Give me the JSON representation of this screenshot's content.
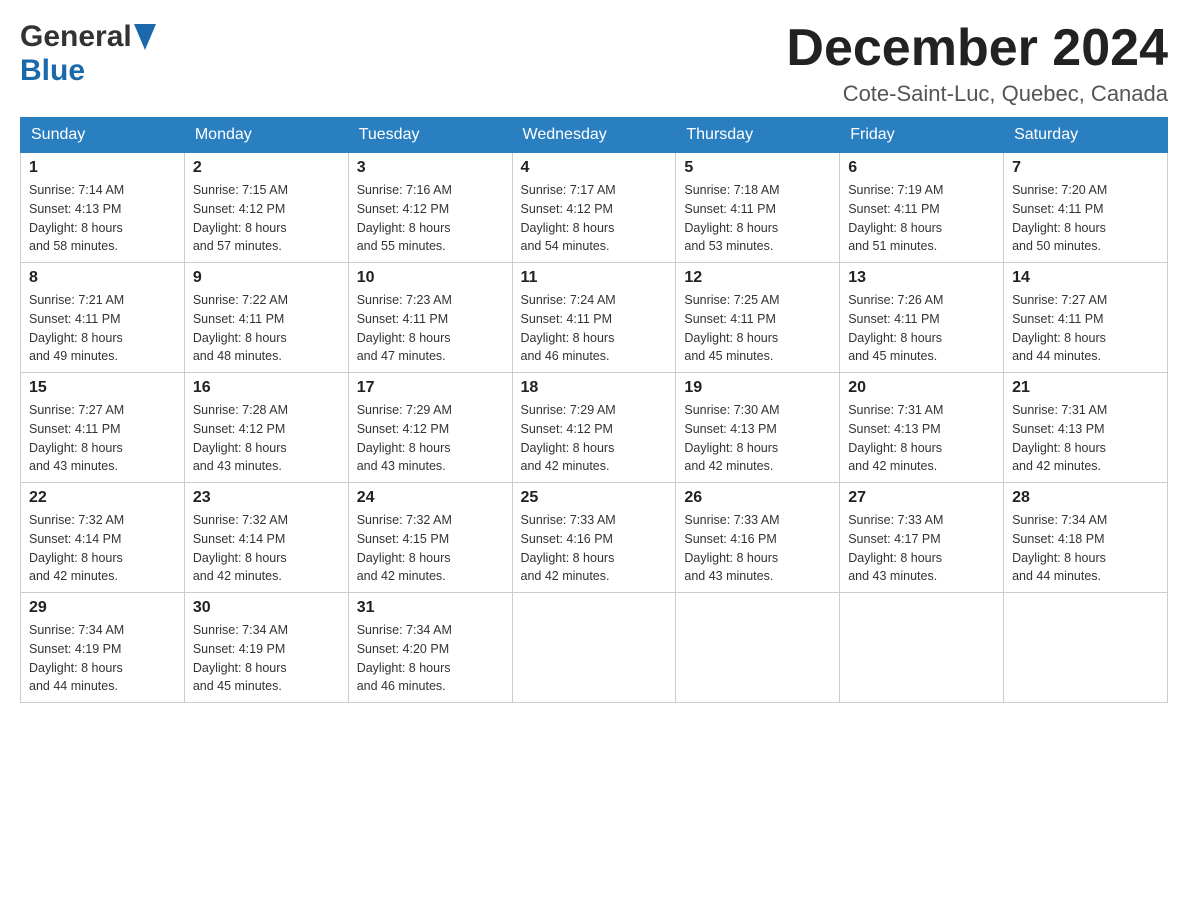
{
  "header": {
    "logo": {
      "general": "General",
      "blue": "Blue"
    },
    "title": "December 2024",
    "location": "Cote-Saint-Luc, Quebec, Canada"
  },
  "days_of_week": [
    "Sunday",
    "Monday",
    "Tuesday",
    "Wednesday",
    "Thursday",
    "Friday",
    "Saturday"
  ],
  "weeks": [
    [
      {
        "day": "1",
        "sunrise": "7:14 AM",
        "sunset": "4:13 PM",
        "daylight": "8 hours and 58 minutes."
      },
      {
        "day": "2",
        "sunrise": "7:15 AM",
        "sunset": "4:12 PM",
        "daylight": "8 hours and 57 minutes."
      },
      {
        "day": "3",
        "sunrise": "7:16 AM",
        "sunset": "4:12 PM",
        "daylight": "8 hours and 55 minutes."
      },
      {
        "day": "4",
        "sunrise": "7:17 AM",
        "sunset": "4:12 PM",
        "daylight": "8 hours and 54 minutes."
      },
      {
        "day": "5",
        "sunrise": "7:18 AM",
        "sunset": "4:11 PM",
        "daylight": "8 hours and 53 minutes."
      },
      {
        "day": "6",
        "sunrise": "7:19 AM",
        "sunset": "4:11 PM",
        "daylight": "8 hours and 51 minutes."
      },
      {
        "day": "7",
        "sunrise": "7:20 AM",
        "sunset": "4:11 PM",
        "daylight": "8 hours and 50 minutes."
      }
    ],
    [
      {
        "day": "8",
        "sunrise": "7:21 AM",
        "sunset": "4:11 PM",
        "daylight": "8 hours and 49 minutes."
      },
      {
        "day": "9",
        "sunrise": "7:22 AM",
        "sunset": "4:11 PM",
        "daylight": "8 hours and 48 minutes."
      },
      {
        "day": "10",
        "sunrise": "7:23 AM",
        "sunset": "4:11 PM",
        "daylight": "8 hours and 47 minutes."
      },
      {
        "day": "11",
        "sunrise": "7:24 AM",
        "sunset": "4:11 PM",
        "daylight": "8 hours and 46 minutes."
      },
      {
        "day": "12",
        "sunrise": "7:25 AM",
        "sunset": "4:11 PM",
        "daylight": "8 hours and 45 minutes."
      },
      {
        "day": "13",
        "sunrise": "7:26 AM",
        "sunset": "4:11 PM",
        "daylight": "8 hours and 45 minutes."
      },
      {
        "day": "14",
        "sunrise": "7:27 AM",
        "sunset": "4:11 PM",
        "daylight": "8 hours and 44 minutes."
      }
    ],
    [
      {
        "day": "15",
        "sunrise": "7:27 AM",
        "sunset": "4:11 PM",
        "daylight": "8 hours and 43 minutes."
      },
      {
        "day": "16",
        "sunrise": "7:28 AM",
        "sunset": "4:12 PM",
        "daylight": "8 hours and 43 minutes."
      },
      {
        "day": "17",
        "sunrise": "7:29 AM",
        "sunset": "4:12 PM",
        "daylight": "8 hours and 43 minutes."
      },
      {
        "day": "18",
        "sunrise": "7:29 AM",
        "sunset": "4:12 PM",
        "daylight": "8 hours and 42 minutes."
      },
      {
        "day": "19",
        "sunrise": "7:30 AM",
        "sunset": "4:13 PM",
        "daylight": "8 hours and 42 minutes."
      },
      {
        "day": "20",
        "sunrise": "7:31 AM",
        "sunset": "4:13 PM",
        "daylight": "8 hours and 42 minutes."
      },
      {
        "day": "21",
        "sunrise": "7:31 AM",
        "sunset": "4:13 PM",
        "daylight": "8 hours and 42 minutes."
      }
    ],
    [
      {
        "day": "22",
        "sunrise": "7:32 AM",
        "sunset": "4:14 PM",
        "daylight": "8 hours and 42 minutes."
      },
      {
        "day": "23",
        "sunrise": "7:32 AM",
        "sunset": "4:14 PM",
        "daylight": "8 hours and 42 minutes."
      },
      {
        "day": "24",
        "sunrise": "7:32 AM",
        "sunset": "4:15 PM",
        "daylight": "8 hours and 42 minutes."
      },
      {
        "day": "25",
        "sunrise": "7:33 AM",
        "sunset": "4:16 PM",
        "daylight": "8 hours and 42 minutes."
      },
      {
        "day": "26",
        "sunrise": "7:33 AM",
        "sunset": "4:16 PM",
        "daylight": "8 hours and 43 minutes."
      },
      {
        "day": "27",
        "sunrise": "7:33 AM",
        "sunset": "4:17 PM",
        "daylight": "8 hours and 43 minutes."
      },
      {
        "day": "28",
        "sunrise": "7:34 AM",
        "sunset": "4:18 PM",
        "daylight": "8 hours and 44 minutes."
      }
    ],
    [
      {
        "day": "29",
        "sunrise": "7:34 AM",
        "sunset": "4:19 PM",
        "daylight": "8 hours and 44 minutes."
      },
      {
        "day": "30",
        "sunrise": "7:34 AM",
        "sunset": "4:19 PM",
        "daylight": "8 hours and 45 minutes."
      },
      {
        "day": "31",
        "sunrise": "7:34 AM",
        "sunset": "4:20 PM",
        "daylight": "8 hours and 46 minutes."
      },
      null,
      null,
      null,
      null
    ]
  ],
  "labels": {
    "sunrise": "Sunrise:",
    "sunset": "Sunset:",
    "daylight": "Daylight:"
  }
}
